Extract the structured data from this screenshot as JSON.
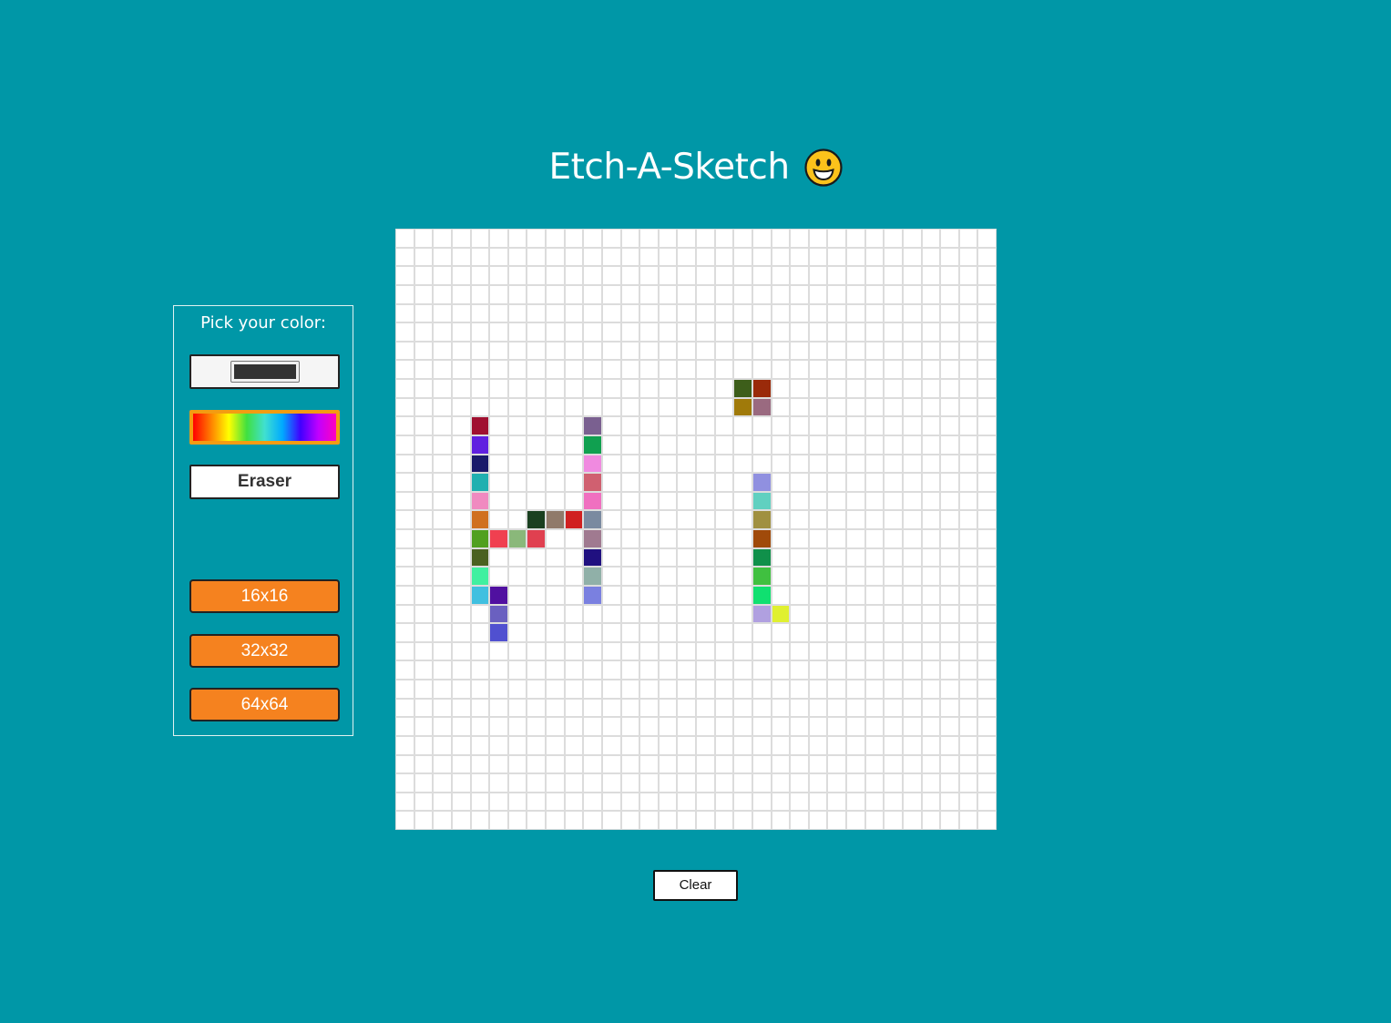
{
  "page": {
    "title": "Etch-A-Sketch",
    "title_icon": "grinning-face-icon"
  },
  "controls": {
    "pick_label": "Pick your color:",
    "current_color": "#333333",
    "rainbow_mode": "rainbow",
    "eraser_label": "Eraser",
    "sizes": [
      "16x16",
      "32x32",
      "64x64"
    ]
  },
  "grid": {
    "columns": 32,
    "rows": 32,
    "painted": [
      {
        "r": 8,
        "c": 18,
        "color": "#3d5e1a"
      },
      {
        "r": 8,
        "c": 19,
        "color": "#9a2a0a"
      },
      {
        "r": 9,
        "c": 18,
        "color": "#a07a0a"
      },
      {
        "r": 9,
        "c": 19,
        "color": "#9a6a80"
      },
      {
        "r": 10,
        "c": 4,
        "color": "#a01030"
      },
      {
        "r": 10,
        "c": 10,
        "color": "#7a6090"
      },
      {
        "r": 11,
        "c": 4,
        "color": "#6020e0"
      },
      {
        "r": 11,
        "c": 10,
        "color": "#10a050"
      },
      {
        "r": 12,
        "c": 4,
        "color": "#1a1a6a"
      },
      {
        "r": 12,
        "c": 10,
        "color": "#f08ae0"
      },
      {
        "r": 13,
        "c": 4,
        "color": "#20b0b0"
      },
      {
        "r": 13,
        "c": 10,
        "color": "#d06070"
      },
      {
        "r": 13,
        "c": 19,
        "color": "#9090e0"
      },
      {
        "r": 14,
        "c": 4,
        "color": "#f08ac0"
      },
      {
        "r": 14,
        "c": 10,
        "color": "#f070c0"
      },
      {
        "r": 14,
        "c": 19,
        "color": "#60d0c0"
      },
      {
        "r": 15,
        "c": 4,
        "color": "#d07020"
      },
      {
        "r": 15,
        "c": 7,
        "color": "#1a4020"
      },
      {
        "r": 15,
        "c": 8,
        "color": "#907a6a"
      },
      {
        "r": 15,
        "c": 9,
        "color": "#d02020"
      },
      {
        "r": 15,
        "c": 10,
        "color": "#7a8aa0"
      },
      {
        "r": 15,
        "c": 19,
        "color": "#a09040"
      },
      {
        "r": 16,
        "c": 4,
        "color": "#50a020"
      },
      {
        "r": 16,
        "c": 5,
        "color": "#f04050"
      },
      {
        "r": 16,
        "c": 6,
        "color": "#8ab87a"
      },
      {
        "r": 16,
        "c": 7,
        "color": "#e04050"
      },
      {
        "r": 16,
        "c": 10,
        "color": "#a07a90"
      },
      {
        "r": 16,
        "c": 19,
        "color": "#a04a0a"
      },
      {
        "r": 17,
        "c": 4,
        "color": "#4a6020"
      },
      {
        "r": 17,
        "c": 10,
        "color": "#201080"
      },
      {
        "r": 17,
        "c": 19,
        "color": "#10904a"
      },
      {
        "r": 18,
        "c": 4,
        "color": "#40f0a0"
      },
      {
        "r": 18,
        "c": 10,
        "color": "#90b0a8"
      },
      {
        "r": 18,
        "c": 19,
        "color": "#40c040"
      },
      {
        "r": 19,
        "c": 4,
        "color": "#40c0e0"
      },
      {
        "r": 19,
        "c": 5,
        "color": "#5010a0"
      },
      {
        "r": 19,
        "c": 10,
        "color": "#7a80e0"
      },
      {
        "r": 19,
        "c": 19,
        "color": "#10e070"
      },
      {
        "r": 20,
        "c": 5,
        "color": "#6a60c0"
      },
      {
        "r": 20,
        "c": 19,
        "color": "#b0a0e0"
      },
      {
        "r": 20,
        "c": 20,
        "color": "#e0f030"
      },
      {
        "r": 21,
        "c": 5,
        "color": "#5050d0"
      }
    ]
  },
  "actions": {
    "clear_label": "Clear"
  }
}
